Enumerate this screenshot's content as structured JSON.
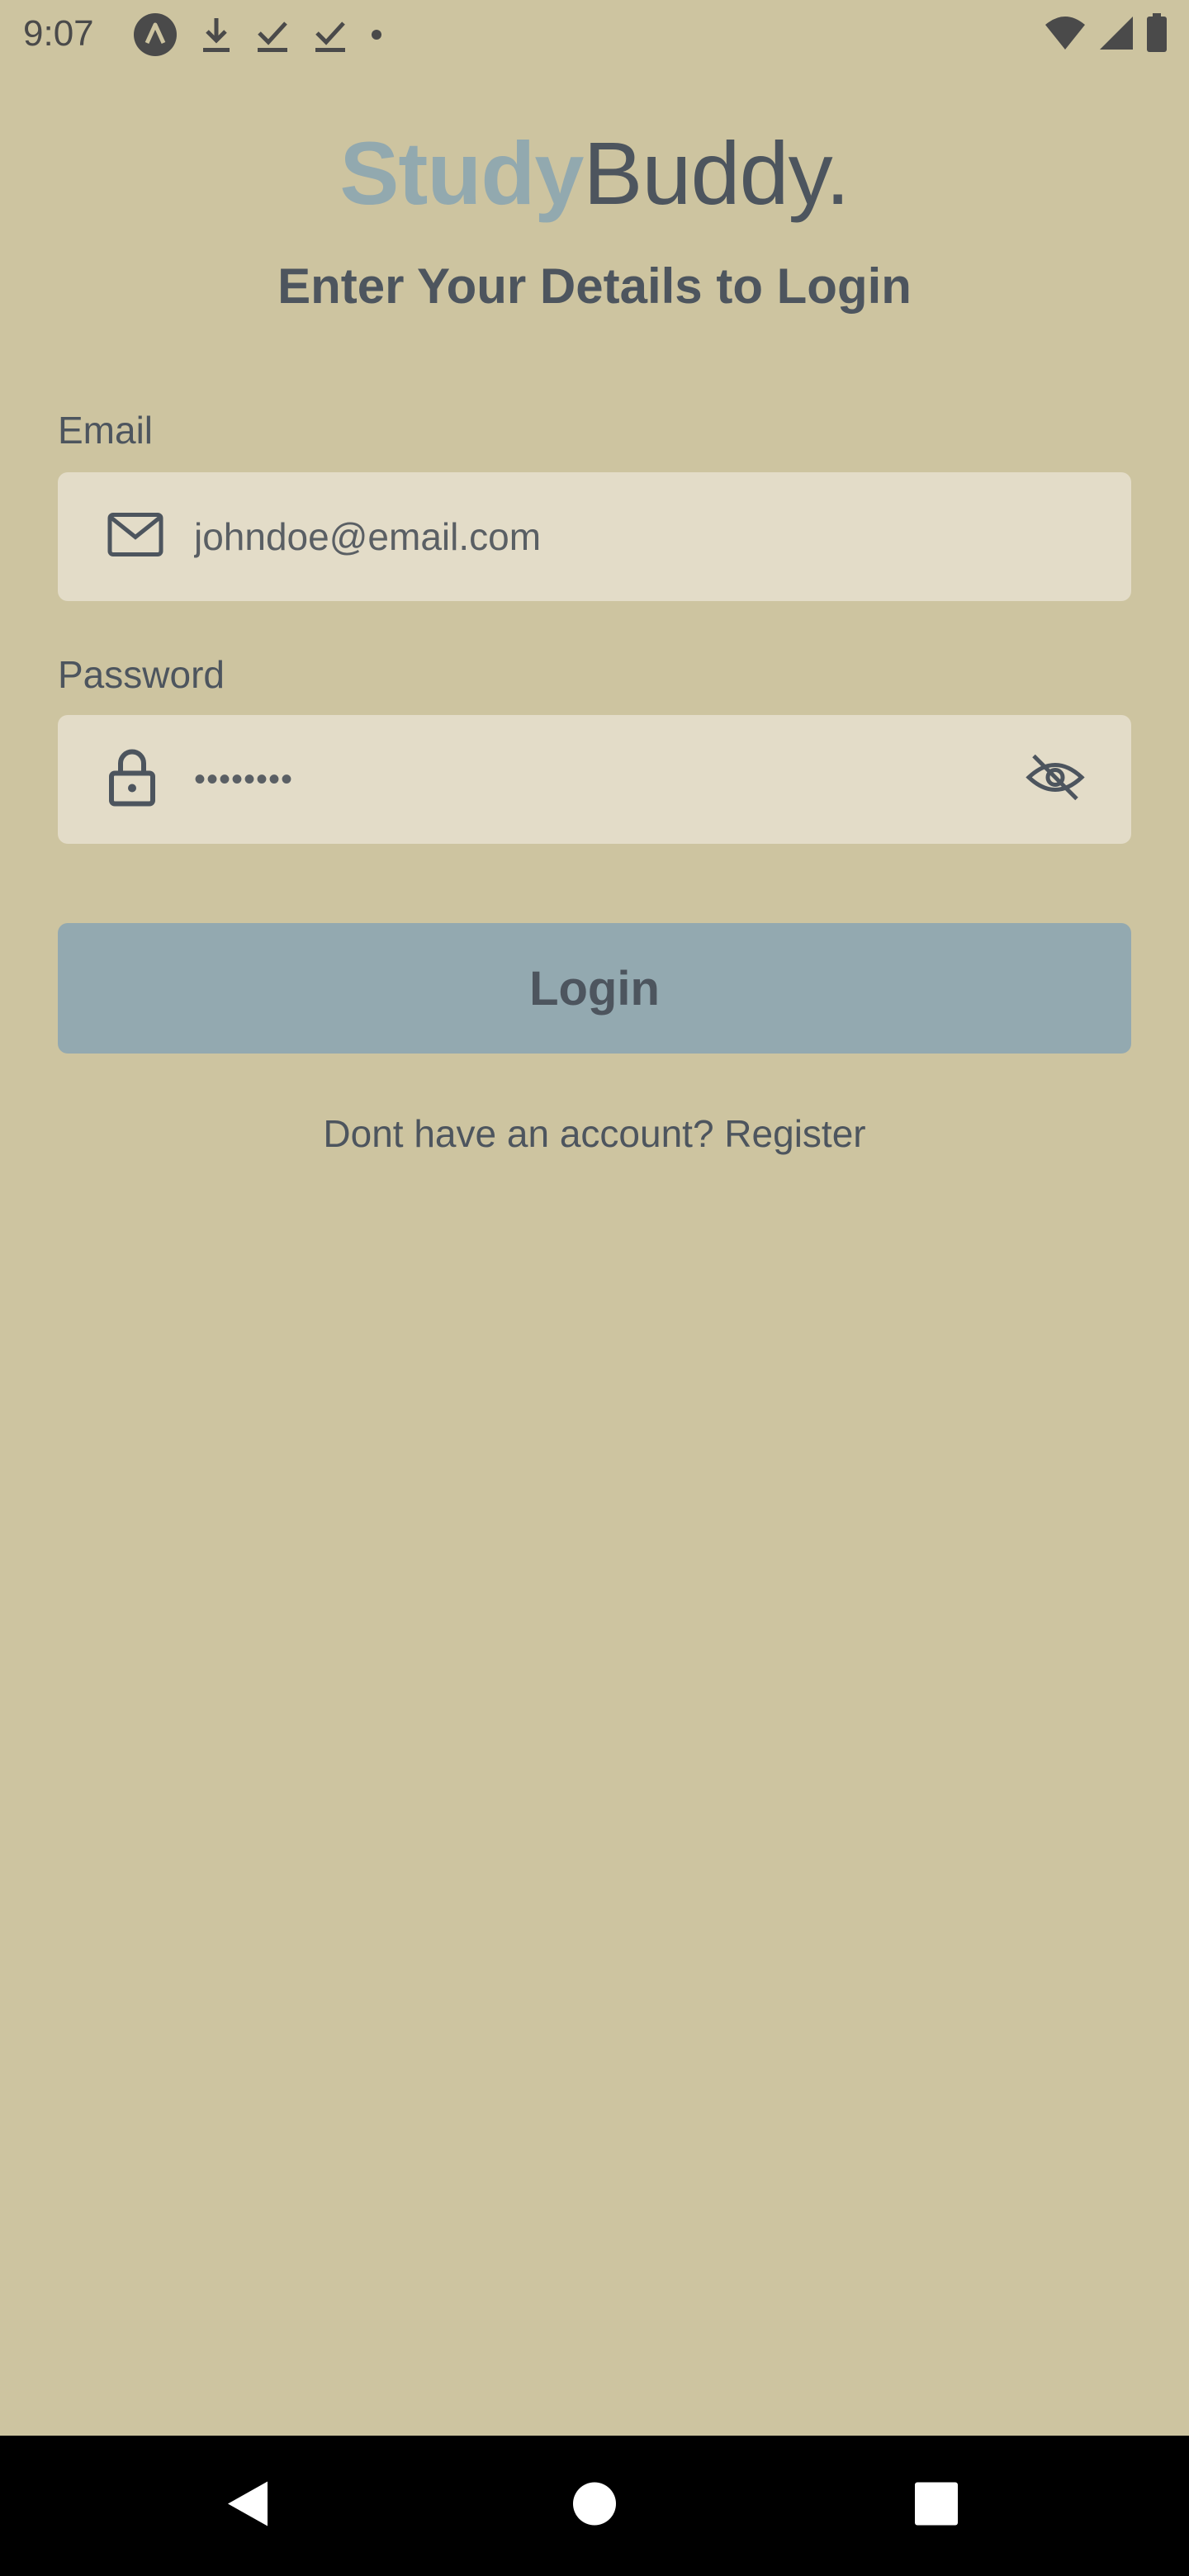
{
  "status_bar": {
    "time": "9:07",
    "left_icons": [
      "app-notification-icon",
      "download-icon",
      "check-download-icon",
      "check-download-icon",
      "dot-icon"
    ],
    "right_icons": [
      "wifi-icon",
      "signal-icon",
      "battery-icon"
    ]
  },
  "brand": {
    "part1": "Study",
    "part2": "Buddy.",
    "accent_color": "#92a9af"
  },
  "subtitle": "Enter Your Details to Login",
  "form": {
    "email": {
      "label": "Email",
      "placeholder": "johndoe@email.com",
      "icon": "mail-icon"
    },
    "password": {
      "label": "Password",
      "value_masked": "••••••••",
      "icon": "lock-icon",
      "toggle_icon": "eye-off-icon"
    },
    "login_label": "Login",
    "register_text": "Dont have an account? Register"
  },
  "nav_bar": {
    "buttons": [
      "back-icon",
      "home-icon",
      "recents-icon"
    ]
  },
  "colors": {
    "background": "#cdc4a0",
    "field_bg": "#e3dcc8",
    "button_bg": "#93a9b0",
    "text": "#4d555e"
  }
}
